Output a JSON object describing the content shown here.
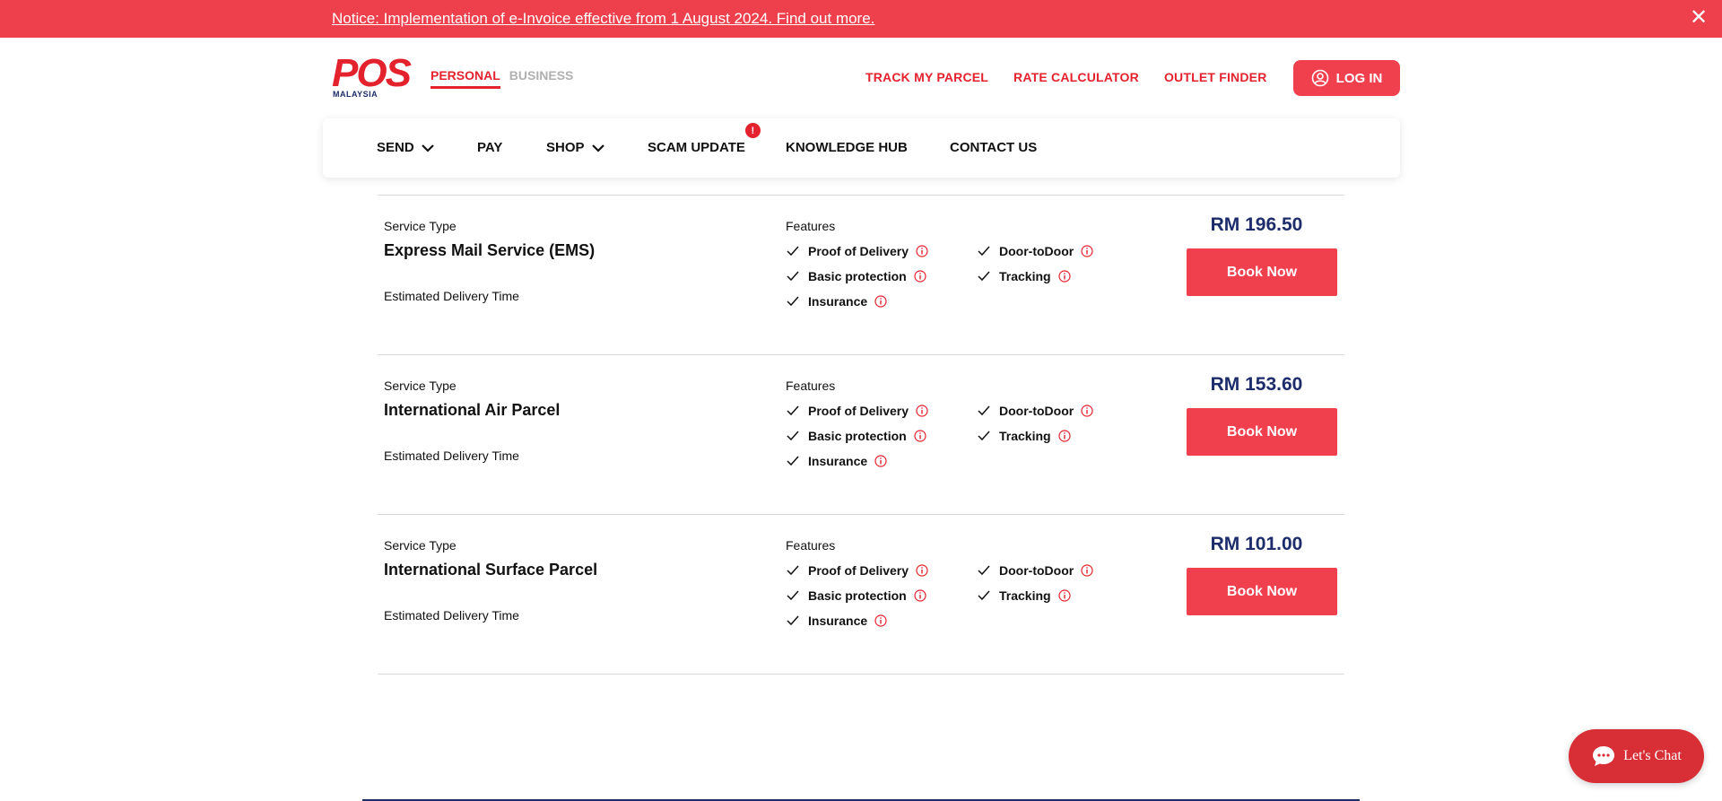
{
  "notice": {
    "text": "Notice: Implementation of e-Invoice effective from 1 August 2024. Find out more.",
    "close_icon": "close-icon"
  },
  "header": {
    "logo_text": "POS",
    "logo_subtext": "MALAYSIA",
    "segments": [
      {
        "label": "PERSONAL",
        "active": true
      },
      {
        "label": "BUSINESS",
        "active": false
      }
    ],
    "top_links": [
      "TRACK MY PARCEL",
      "RATE CALCULATOR",
      "OUTLET FINDER"
    ],
    "login_label": "LOG IN"
  },
  "nav": {
    "items": [
      {
        "label": "SEND",
        "dropdown": true
      },
      {
        "label": "PAY",
        "dropdown": false
      },
      {
        "label": "SHOP",
        "dropdown": true
      },
      {
        "label": "SCAM UPDATE",
        "dropdown": false,
        "badge": "!"
      },
      {
        "label": "KNOWLEDGE HUB",
        "dropdown": false
      },
      {
        "label": "CONTACT US",
        "dropdown": false
      }
    ]
  },
  "results": [
    {
      "service_type_label": "Service Type",
      "service_name": "Express Mail Service (EMS)",
      "eta_label": "Estimated Delivery Time",
      "features_label": "Features",
      "features_left": [
        "Proof of Delivery",
        "Basic protection",
        "Insurance"
      ],
      "features_right": [
        "Door-toDoor",
        "Tracking"
      ],
      "price": "RM 196.50",
      "book_label": "Book Now"
    },
    {
      "service_type_label": "Service Type",
      "service_name": "International Air Parcel",
      "eta_label": "Estimated Delivery Time",
      "features_label": "Features",
      "features_left": [
        "Proof of Delivery",
        "Basic protection",
        "Insurance"
      ],
      "features_right": [
        "Door-toDoor",
        "Tracking"
      ],
      "price": "RM 153.60",
      "book_label": "Book Now"
    },
    {
      "service_type_label": "Service Type",
      "service_name": "International Surface Parcel",
      "eta_label": "Estimated Delivery Time",
      "features_label": "Features",
      "features_left": [
        "Proof of Delivery",
        "Basic protection",
        "Insurance"
      ],
      "features_right": [
        "Door-toDoor",
        "Tracking"
      ],
      "price": "RM 101.00",
      "book_label": "Book Now"
    }
  ],
  "chat": {
    "label": "Let's Chat",
    "icon": "chat-bubble-icon"
  },
  "colors": {
    "brand_red": "#e4222e",
    "button_red": "#f0404e",
    "notice_red": "#ee404c",
    "navy": "#1d2c6b"
  }
}
